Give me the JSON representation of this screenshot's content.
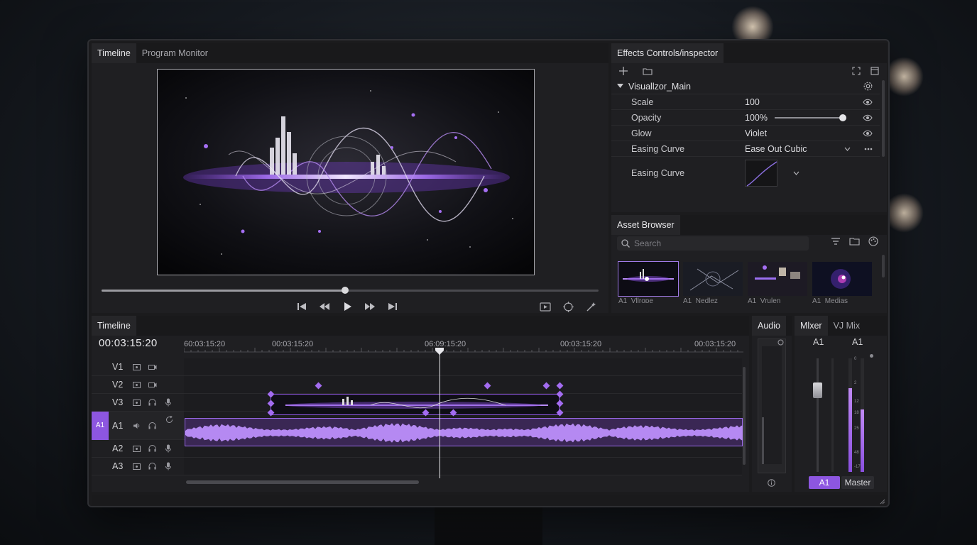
{
  "monitor_panel": {
    "tabs": [
      {
        "label": "Timeline",
        "active": true
      },
      {
        "label": "Program Monitor",
        "active": false
      }
    ],
    "scrub_progress": 0.49
  },
  "inspector": {
    "tab": "Effects Controls/inspector",
    "effect_name": "Visuallzor_Main",
    "properties": [
      {
        "label": "Scale",
        "value": "100"
      },
      {
        "label": "Opacity",
        "value": "100%",
        "slider": 1.0
      },
      {
        "label": "Glow",
        "value": "Violet"
      },
      {
        "label": "Easing Curve",
        "value": "Ease Out Cubic"
      },
      {
        "label": "Easing Curve"
      }
    ]
  },
  "assets": {
    "tab": "Asset Browser",
    "search_placeholder": "Search",
    "thumbs": [
      {
        "label": "A1_Vllrope"
      },
      {
        "label": "A1_Nedlez"
      },
      {
        "label": "A1_Vrulen"
      },
      {
        "label": "A1_Medias"
      }
    ]
  },
  "timeline": {
    "title": "Timeline",
    "timecode": "00:03:15:20",
    "ruler_labels": [
      "60:03:15:20",
      "00:03:15:20",
      "06:09:15:20",
      "00:03:15:20",
      "00:03:15:20"
    ],
    "tracks": [
      {
        "name": "V1",
        "kind": "video"
      },
      {
        "name": "V2",
        "kind": "video"
      },
      {
        "name": "V3",
        "kind": "video"
      },
      {
        "name": "A1",
        "kind": "audio",
        "selected": true,
        "badge": "A1"
      },
      {
        "name": "A2",
        "kind": "audio"
      },
      {
        "name": "A3",
        "kind": "audio"
      }
    ]
  },
  "audio_panel": {
    "tab": "Audio"
  },
  "mixer": {
    "tabs": [
      {
        "label": "Mlxer",
        "active": true
      },
      {
        "label": "VJ Mix",
        "active": false
      }
    ],
    "channel_labels": [
      "A1",
      "A1"
    ],
    "meter_scale": [
      "0",
      "2",
      "12",
      "18",
      "25",
      "48",
      "-17"
    ],
    "buttons": [
      {
        "label": "A1",
        "active": true
      },
      {
        "label": "Master",
        "active": false
      }
    ],
    "levels": [
      0.74,
      0.55
    ]
  },
  "colors": {
    "accent": "#9b5fe8",
    "panel": "#1f1f22",
    "tab_active": "#262629"
  }
}
